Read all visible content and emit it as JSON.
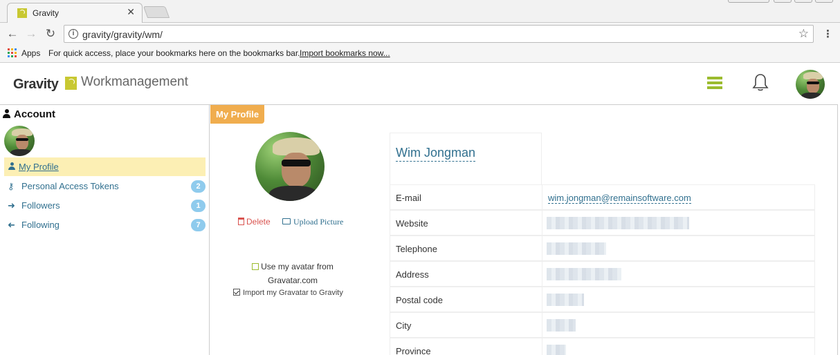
{
  "browser": {
    "tab_title": "Gravity",
    "url": "gravity/gravity/wm/",
    "apps_label": "Apps",
    "bookmark_hint": "For quick access, place your bookmarks here on the bookmarks bar.",
    "import_bookmarks": "Import bookmarks now..."
  },
  "header": {
    "logo_text": "Gravity",
    "app_name": "Workmanagement",
    "accent_color": "#9bbb2e"
  },
  "sidebar": {
    "heading": "Account",
    "items": [
      {
        "label": "My Profile",
        "icon": "user-icon",
        "badge": null,
        "active": true
      },
      {
        "label": "Personal Access Tokens",
        "icon": "key-icon",
        "badge": "2"
      },
      {
        "label": "Followers",
        "icon": "arrow-right-icon",
        "badge": "1"
      },
      {
        "label": "Following",
        "icon": "arrow-left-icon",
        "badge": "7"
      }
    ]
  },
  "main": {
    "tab_label": "My Profile",
    "delete_label": "Delete",
    "upload_label": "Upload Picture",
    "use_gravatar_label": "Use my avatar from Gravatar.com",
    "import_gravatar_label": "Import my Gravatar to Gravity",
    "user_name": "Wim Jongman",
    "fields": [
      {
        "label": "E-mail",
        "value": "wim.jongman@remainsoftware.com"
      },
      {
        "label": "Website",
        "value": null
      },
      {
        "label": "Telephone",
        "value": null
      },
      {
        "label": "Address",
        "value": null
      },
      {
        "label": "Postal code",
        "value": null
      },
      {
        "label": "City",
        "value": null
      },
      {
        "label": "Province",
        "value": null
      }
    ]
  }
}
